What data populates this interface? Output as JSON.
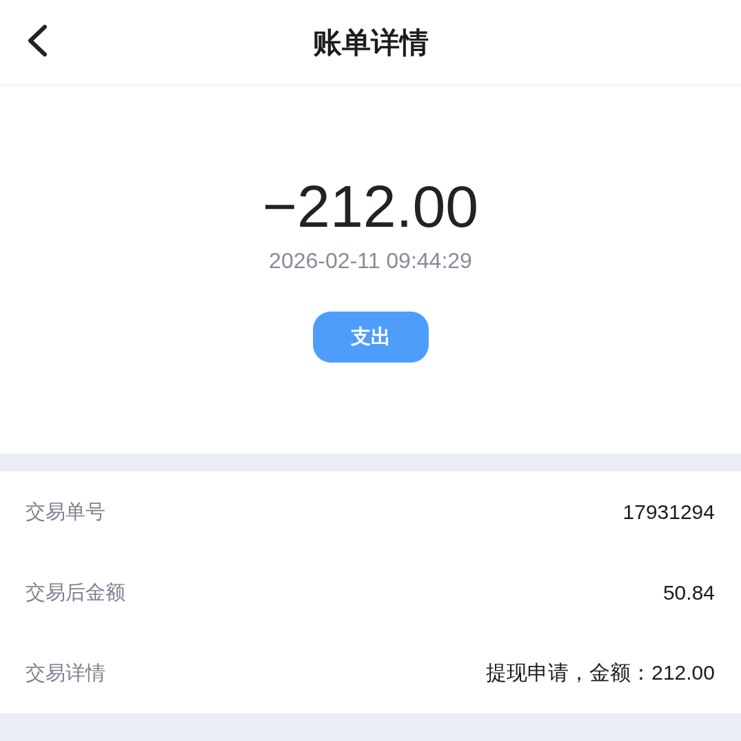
{
  "header": {
    "title": "账单详情"
  },
  "summary": {
    "amount": "−212.00",
    "time": "2026-02-11 09:44:29",
    "tag": "支出"
  },
  "details": [
    {
      "label": "交易单号",
      "value": "17931294"
    },
    {
      "label": "交易后金额",
      "value": "50.84"
    },
    {
      "label": "交易详情",
      "value": "提现申请，金额：212.00"
    }
  ]
}
